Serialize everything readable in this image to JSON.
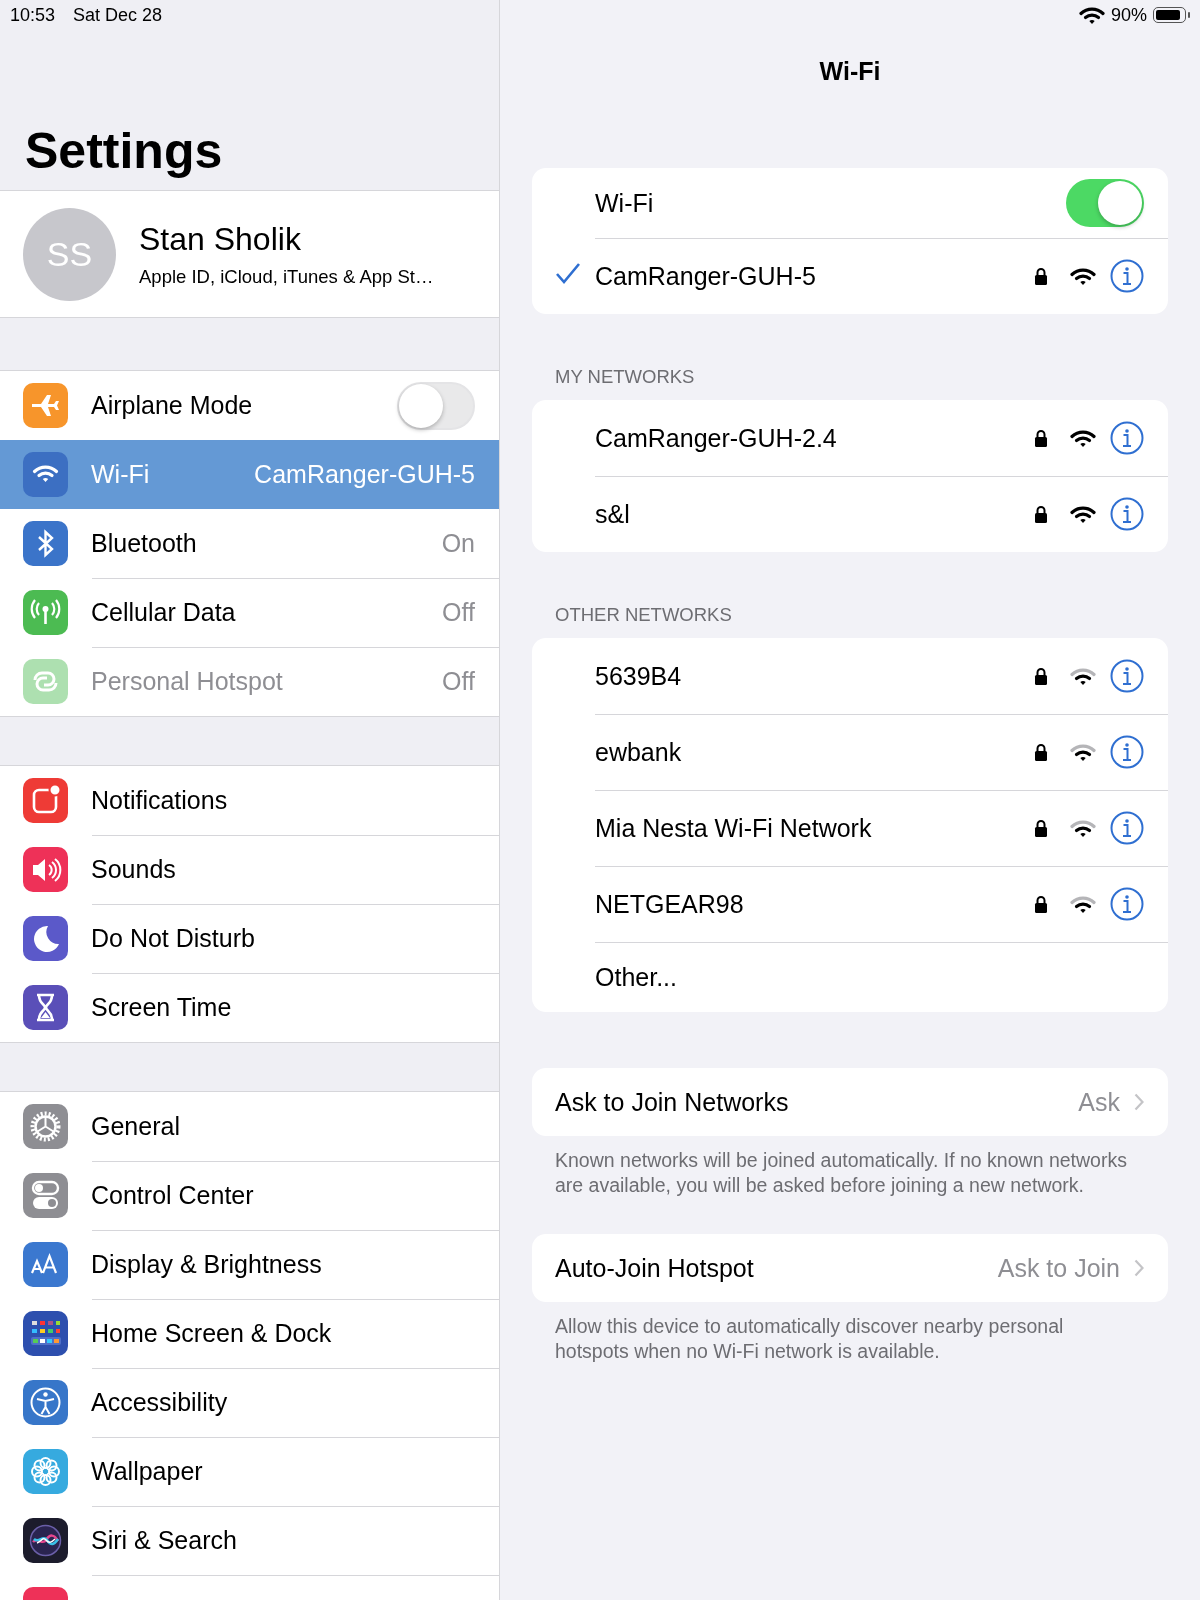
{
  "status_bar": {
    "time": "10:53",
    "date": "Sat Dec 28",
    "battery": "90%"
  },
  "sidebar": {
    "title": "Settings",
    "profile": {
      "initials": "SS",
      "name": "Stan Sholik",
      "subtitle": "Apple ID, iCloud, iTunes & App St…"
    },
    "groups": [
      {
        "items": [
          {
            "label": "Airplane Mode",
            "kind": "toggle",
            "on": false,
            "selected": false,
            "disabled": false
          },
          {
            "label": "Wi-Fi",
            "kind": "value",
            "value": "CamRanger-GUH-5",
            "selected": true,
            "disabled": false
          },
          {
            "label": "Bluetooth",
            "kind": "value",
            "value": "On",
            "selected": false,
            "disabled": false
          },
          {
            "label": "Cellular Data",
            "kind": "value",
            "value": "Off",
            "selected": false,
            "disabled": false
          },
          {
            "label": "Personal Hotspot",
            "kind": "value",
            "value": "Off",
            "selected": false,
            "disabled": true
          }
        ]
      },
      {
        "items": [
          {
            "label": "Notifications",
            "kind": "link",
            "selected": false,
            "disabled": false
          },
          {
            "label": "Sounds",
            "kind": "link",
            "selected": false,
            "disabled": false
          },
          {
            "label": "Do Not Disturb",
            "kind": "link",
            "selected": false,
            "disabled": false
          },
          {
            "label": "Screen Time",
            "kind": "link",
            "selected": false,
            "disabled": false
          }
        ]
      },
      {
        "items": [
          {
            "label": "General",
            "kind": "link",
            "selected": false,
            "disabled": false
          },
          {
            "label": "Control Center",
            "kind": "link",
            "selected": false,
            "disabled": false
          },
          {
            "label": "Display & Brightness",
            "kind": "link",
            "selected": false,
            "disabled": false
          },
          {
            "label": "Home Screen & Dock",
            "kind": "link",
            "selected": false,
            "disabled": false
          },
          {
            "label": "Accessibility",
            "kind": "link",
            "selected": false,
            "disabled": false
          },
          {
            "label": "Wallpaper",
            "kind": "link",
            "selected": false,
            "disabled": false
          },
          {
            "label": "Siri & Search",
            "kind": "link",
            "selected": false,
            "disabled": false
          }
        ]
      }
    ]
  },
  "wifi": {
    "title": "Wi-Fi",
    "toggle_label": "Wi-Fi",
    "on": true,
    "current": {
      "name": "CamRanger-GUH-5",
      "locked": true,
      "weak_signal": false
    },
    "sections": [
      {
        "header": "MY NETWORKS",
        "networks": [
          {
            "name": "CamRanger-GUH-2.4",
            "locked": true,
            "weak_signal": false
          },
          {
            "name": "s&l",
            "locked": true,
            "weak_signal": false
          }
        ]
      },
      {
        "header": "OTHER NETWORKS",
        "networks": [
          {
            "name": "5639B4",
            "locked": true,
            "weak_signal": true
          },
          {
            "name": "ewbank",
            "locked": true,
            "weak_signal": true
          },
          {
            "name": "Mia Nesta Wi-Fi Network",
            "locked": true,
            "weak_signal": true
          },
          {
            "name": "NETGEAR98",
            "locked": true,
            "weak_signal": true
          }
        ],
        "other": "Other..."
      }
    ],
    "ask_to_join": {
      "label": "Ask to Join Networks",
      "value": "Ask",
      "footer": "Known networks will be joined automatically. If no known networks are available, you will be asked before joining a new network."
    },
    "auto_join": {
      "label": "Auto-Join Hotspot",
      "value": "Ask to Join",
      "footer": "Allow this device to automatically discover nearby personal hotspots when no Wi-Fi network is available."
    }
  }
}
